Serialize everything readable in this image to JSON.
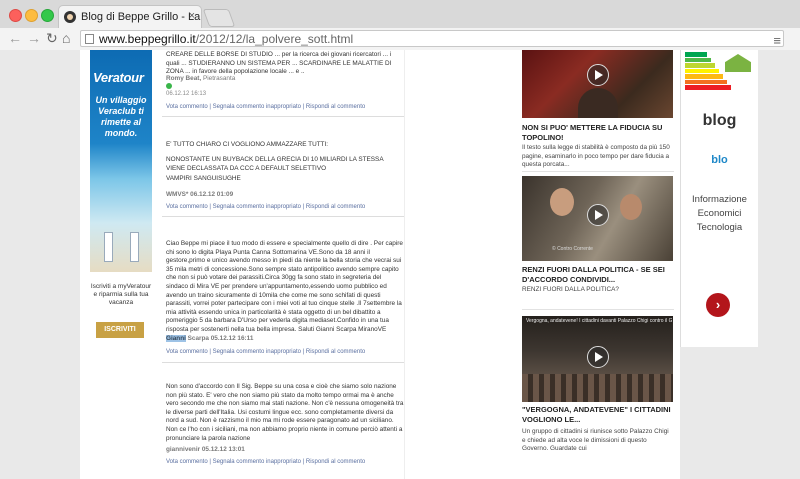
{
  "browser": {
    "tab_title": "Blog di Beppe Grillo - La polve",
    "tab_close": "×",
    "url_domain": "www.beppegrillo.it",
    "url_path": "/2012/12/la_polvere_sott.html"
  },
  "ad": {
    "logo": "Veratour",
    "text": "Un villaggio Veraclub ti rimette al mondo.",
    "sub": "Iscriviti a myVeratour e riparmia sulla tua vacanza",
    "button": "ISCRIVITI"
  },
  "comments": [
    {
      "text": "CREARE DELLE BORSE DI STUDIO ... per la ricerca dei giovani ricercatori ... i quali ... STUDIERANNO UN SISTEMA PER ... SCARDINARE LE MALATTIE DI ZONA ... in favore della popolazione locale ... e ..",
      "author": "Romy Beat,",
      "location": "Pietrasanta",
      "date": "06.12.12 16:13",
      "actions": "Vota commento | Segnala commento inappropriato | Rispondi al commento"
    },
    {
      "paragraphs": [
        "E' TUTTO CHIARO CI VOGLIONO AMMAZZARE TUTTI:",
        "NONOSTANTE UN BUYBACK DELLA GRECIA DI 10 MILIARDI LA STESSA VIENE DECLASSATA DA CCC A DEFAULT SELETTIVO",
        "VAMPIRI SANGUISUGHE"
      ],
      "author_date": "WMVS* 06.12.12 01:09",
      "actions": "Vota commento | Segnala commento inappropriato | Rispondi al commento"
    },
    {
      "text": "Ciao Beppe mi piace il tuo modo di essere e specialmente quello di dire . Per capire chi sono lo digita Playa Punta Canna Sottomarina VE.Sono da 18 anni il gestore,primo e unico avendo messo in piedi da niente la bella storia che vecrai sui 35 mila metri di concessione.Sono sempre stato antipolitico avendo sempre capito che non si può votare dei parassiti.Circa 30gg fa sono stato in segreteria del sindaco di Mira VE per prendere un'appuntamento,essendo uomo pubblico ed avendo un traino sicuramente di 10mila che come me sono schifati di questi parassiti, vorrei poter partecipare con i miei voti al tuo cinque stelle .Il 7settembre la mia attività essendo unica in particolarità è stata oggetto di un bel dibattito a pomeriggio 5 da barbara D'Urso per vederla digita mediaset.Confido in una tua risposta per sostenerti nella tua bella impresa. Saluti Gianni Scarpa MiranoVE",
      "author_highlight": "Gianni",
      "author_rest": " Scarpa 05.12.12 16:11",
      "actions": "Vota commento | Segnala commento inappropriato | Rispondi al commento"
    },
    {
      "text": "Non sono d'accordo con Il Sig. Beppe su una cosa e cioè che siamo solo nazione non più stato. E' vero che non siamo più stato da molto tempo ormai ma è anche vero secondo me che non siamo mai stati nazione. Non c'è nessuna omogeneità tra le diverse parti dell'Italia. Usi costumi lingue ecc. sono completamente diversi da nord a sud. Non è razzismo il mio ma mi rode essere paragonato ad un siciliano. Non ce l'ho con i siciliani, ma non abbiamo proprio niente in comune perciò attenti a pronunciare la parola nazione",
      "author_date": "giannivenir 05.12.12 13:01",
      "actions": "Vota commento | Segnala commento inappropriato | Rispondi al commento"
    }
  ],
  "videos": [
    {
      "title": "NON SI PUO' METTERE LA FIDUCIA SU TOPOLINO!",
      "desc": "Il testo sulla legge di stabilità è composto da più 150 pagine, esaminarlo in poco tempo per dare fiducia a questa porcata..."
    },
    {
      "title": "RENZI FUORI DALLA POLITICA - SE SEI D'ACCORDO CONDIVIDI...",
      "desc": "RENZI FUORI DALLA POLITICA?",
      "caption": "© Contro Corrente"
    },
    {
      "title": "\"VERGOGNA, ANDATEVENE\" I CITTADINI VOGLIONO LE...",
      "desc": "Un gruppo di cittadini si riunisce sotto Palazzo Chigi e chiede ad alta voce le dimissioni di questo Governo. Guardate cui",
      "caption": "Vergogna, andatevene! I cittadini davanti Palazzo Chigi contro il Governo"
    }
  ],
  "blogbox": {
    "title": "blog",
    "small": "blo",
    "body": "Informazione Economici Tecnologia",
    "button": "›"
  }
}
